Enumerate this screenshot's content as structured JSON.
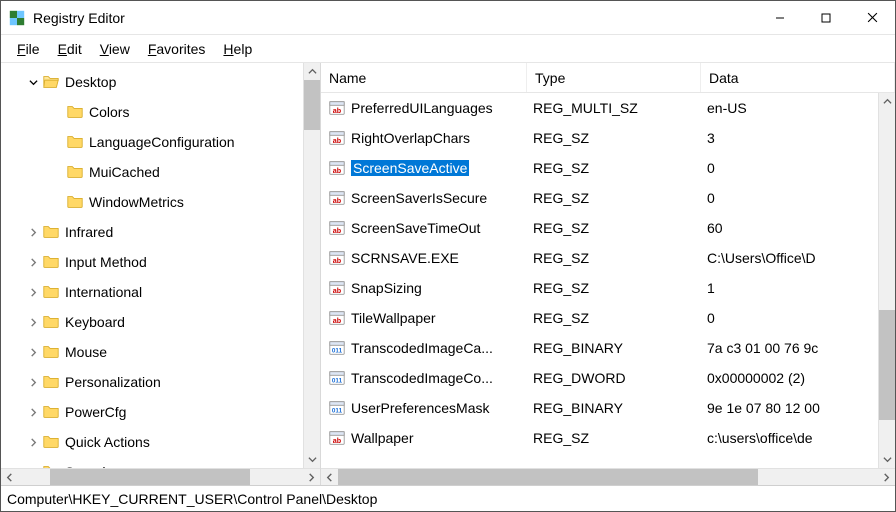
{
  "window_title": "Registry Editor",
  "menubar": {
    "file": {
      "label": "File",
      "accel_index": 0
    },
    "edit": {
      "label": "Edit",
      "accel_index": 0
    },
    "view": {
      "label": "View",
      "accel_index": 0
    },
    "favorites": {
      "label": "Favorites",
      "accel_index": 0
    },
    "help": {
      "label": "Help",
      "accel_index": 0
    }
  },
  "tree": {
    "items": [
      {
        "label": "Desktop",
        "depth": 0,
        "expanded": true,
        "has_children": true,
        "open": true
      },
      {
        "label": "Colors",
        "depth": 1,
        "expanded": false,
        "has_children": false
      },
      {
        "label": "LanguageConfiguration",
        "depth": 1,
        "expanded": false,
        "has_children": false
      },
      {
        "label": "MuiCached",
        "depth": 1,
        "expanded": false,
        "has_children": false
      },
      {
        "label": "WindowMetrics",
        "depth": 1,
        "expanded": false,
        "has_children": false
      },
      {
        "label": "Infrared",
        "depth": 0,
        "expanded": false,
        "has_children": true
      },
      {
        "label": "Input Method",
        "depth": 0,
        "expanded": false,
        "has_children": true
      },
      {
        "label": "International",
        "depth": 0,
        "expanded": false,
        "has_children": true
      },
      {
        "label": "Keyboard",
        "depth": 0,
        "expanded": false,
        "has_children": true
      },
      {
        "label": "Mouse",
        "depth": 0,
        "expanded": false,
        "has_children": true
      },
      {
        "label": "Personalization",
        "depth": 0,
        "expanded": false,
        "has_children": true
      },
      {
        "label": "PowerCfg",
        "depth": 0,
        "expanded": false,
        "has_children": true
      },
      {
        "label": "Quick Actions",
        "depth": 0,
        "expanded": false,
        "has_children": true
      },
      {
        "label": "Sound",
        "depth": 0,
        "expanded": false,
        "has_children": true
      }
    ]
  },
  "list": {
    "columns": {
      "name": "Name",
      "type": "Type",
      "data": "Data"
    },
    "rows": [
      {
        "icon": "sz",
        "name": "PreferredUILanguages",
        "type": "REG_MULTI_SZ",
        "data": "en-US"
      },
      {
        "icon": "sz",
        "name": "RightOverlapChars",
        "type": "REG_SZ",
        "data": "3"
      },
      {
        "icon": "sz",
        "name": "ScreenSaveActive",
        "type": "REG_SZ",
        "data": "0",
        "selected": true
      },
      {
        "icon": "sz",
        "name": "ScreenSaverIsSecure",
        "type": "REG_SZ",
        "data": "0"
      },
      {
        "icon": "sz",
        "name": "ScreenSaveTimeOut",
        "type": "REG_SZ",
        "data": "60"
      },
      {
        "icon": "sz",
        "name": "SCRNSAVE.EXE",
        "type": "REG_SZ",
        "data": "C:\\Users\\Office\\D"
      },
      {
        "icon": "sz",
        "name": "SnapSizing",
        "type": "REG_SZ",
        "data": "1"
      },
      {
        "icon": "sz",
        "name": "TileWallpaper",
        "type": "REG_SZ",
        "data": "0"
      },
      {
        "icon": "bin",
        "name": "TranscodedImageCa...",
        "type": "REG_BINARY",
        "data": "7a c3 01 00 76 9c"
      },
      {
        "icon": "bin",
        "name": "TranscodedImageCo...",
        "type": "REG_DWORD",
        "data": "0x00000002 (2)"
      },
      {
        "icon": "bin",
        "name": "UserPreferencesMask",
        "type": "REG_BINARY",
        "data": "9e 1e 07 80 12 00"
      },
      {
        "icon": "sz",
        "name": "Wallpaper",
        "type": "REG_SZ",
        "data": "c:\\users\\office\\de"
      }
    ]
  },
  "statusbar": {
    "path": "Computer\\HKEY_CURRENT_USER\\Control Panel\\Desktop"
  }
}
